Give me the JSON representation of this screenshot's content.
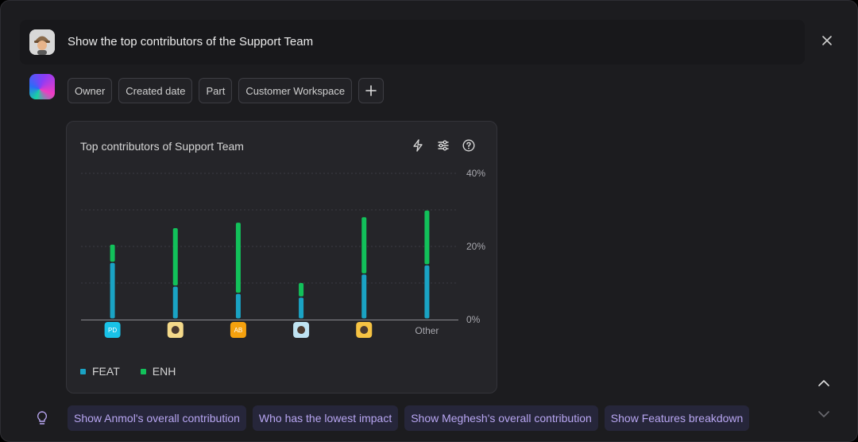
{
  "prompt": {
    "text": "Show the top contributors of the Support Team"
  },
  "filters": [
    {
      "label": "Owner"
    },
    {
      "label": "Created date"
    },
    {
      "label": "Part"
    },
    {
      "label": "Customer Workspace"
    }
  ],
  "chart_card": {
    "title": "Top contributors of Support Team",
    "tools": [
      "lightning-icon",
      "sliders-icon",
      "help-icon"
    ]
  },
  "chart_data": {
    "type": "bar",
    "stacked": true,
    "title": "Top contributors of Support Team",
    "categories": [
      "PD",
      "avatar-2",
      "AB",
      "avatar-4",
      "avatar-5",
      "Other"
    ],
    "category_labels": [
      "PD",
      "",
      "AB",
      "",
      "",
      "Other"
    ],
    "category_colors": [
      "#19c2e8",
      "#f4d98a",
      "#f5a10e",
      "#bfe3f2",
      "#f6c343",
      ""
    ],
    "series": [
      {
        "name": "FEAT",
        "color": "#1aa3c4",
        "values": [
          15.5,
          9,
          7,
          6,
          12.3,
          14.8
        ]
      },
      {
        "name": "ENH",
        "color": "#12c15a",
        "values": [
          5,
          16,
          19.5,
          4,
          15.7,
          15
        ]
      }
    ],
    "ylim": [
      0,
      40
    ],
    "yticks": [
      "0%",
      "20%",
      "40%"
    ],
    "grid": true,
    "legend_position": "bottom-left"
  },
  "suggestions": [
    "Show Anmol's overall contribution",
    "Who has the lowest impact",
    "Show Meghesh's overall contribution",
    "Show Features breakdown"
  ]
}
